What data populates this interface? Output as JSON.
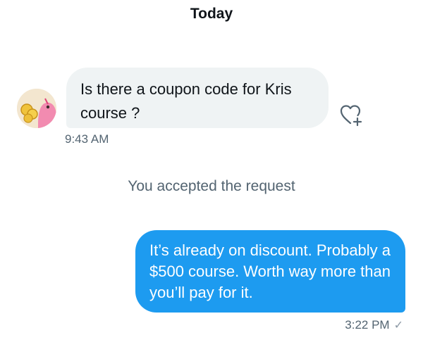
{
  "divider": {
    "label": "Today"
  },
  "incoming": {
    "text": "Is there a coupon code for Kris course ?",
    "time": "9:43 AM",
    "avatar_icon": "avatar-image",
    "react_icon": "heart-plus-icon"
  },
  "system": {
    "text": "You accepted the request"
  },
  "outgoing": {
    "text": "It’s already on discount. Probably a $500 course. Worth way more than you’ll pay for it.",
    "time": "3:22 PM",
    "status_icon": "check-icon",
    "status_glyph": "✓"
  },
  "colors": {
    "accent": "#1d9bf0",
    "incoming_bubble": "#eff3f4",
    "muted_text": "#536471"
  }
}
